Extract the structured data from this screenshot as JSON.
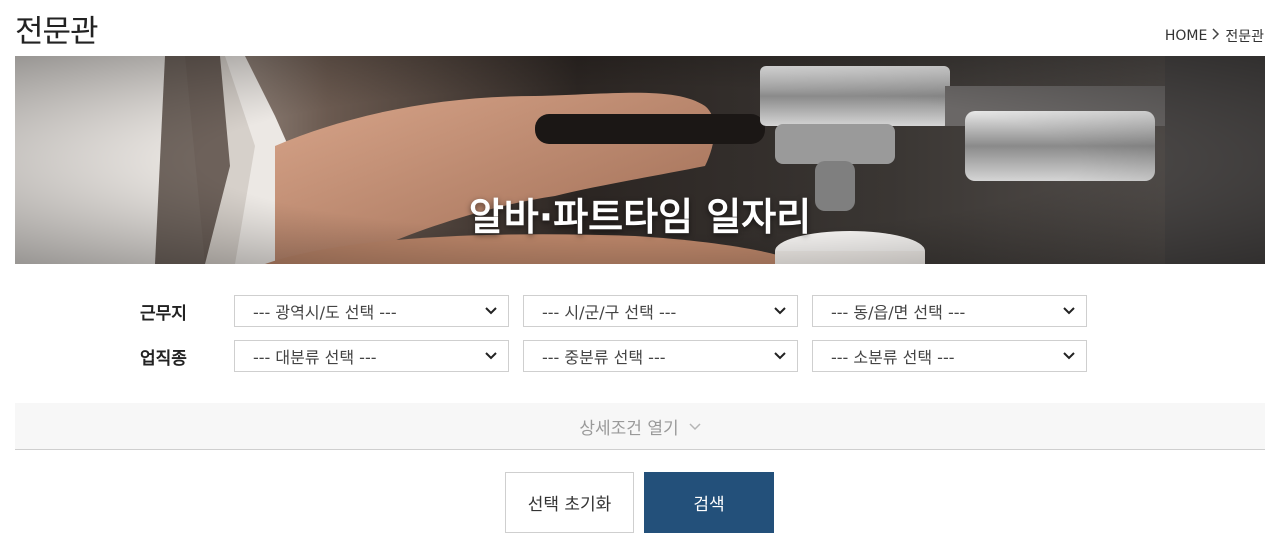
{
  "header": {
    "title": "전문관",
    "breadcrumb": {
      "home": "HOME",
      "current": "전문관"
    }
  },
  "banner": {
    "title": "알바·파트타임 일자리"
  },
  "filters": {
    "location": {
      "label": "근무지",
      "province": "--- 광역시/도 선택 ---",
      "city": "--- 시/군/구 선택 ---",
      "town": "--- 동/읍/면 선택 ---"
    },
    "job": {
      "label": "업직종",
      "major": "--- 대분류 선택 ---",
      "middle": "--- 중분류 선택 ---",
      "minor": "--- 소분류 선택 ---"
    }
  },
  "detail_toggle": {
    "label": "상세조건 열기"
  },
  "actions": {
    "reset_label": "선택 초기화",
    "search_label": "검색"
  },
  "colors": {
    "search_button": "#23507a",
    "detail_bar_bg": "#f7f7f7"
  }
}
